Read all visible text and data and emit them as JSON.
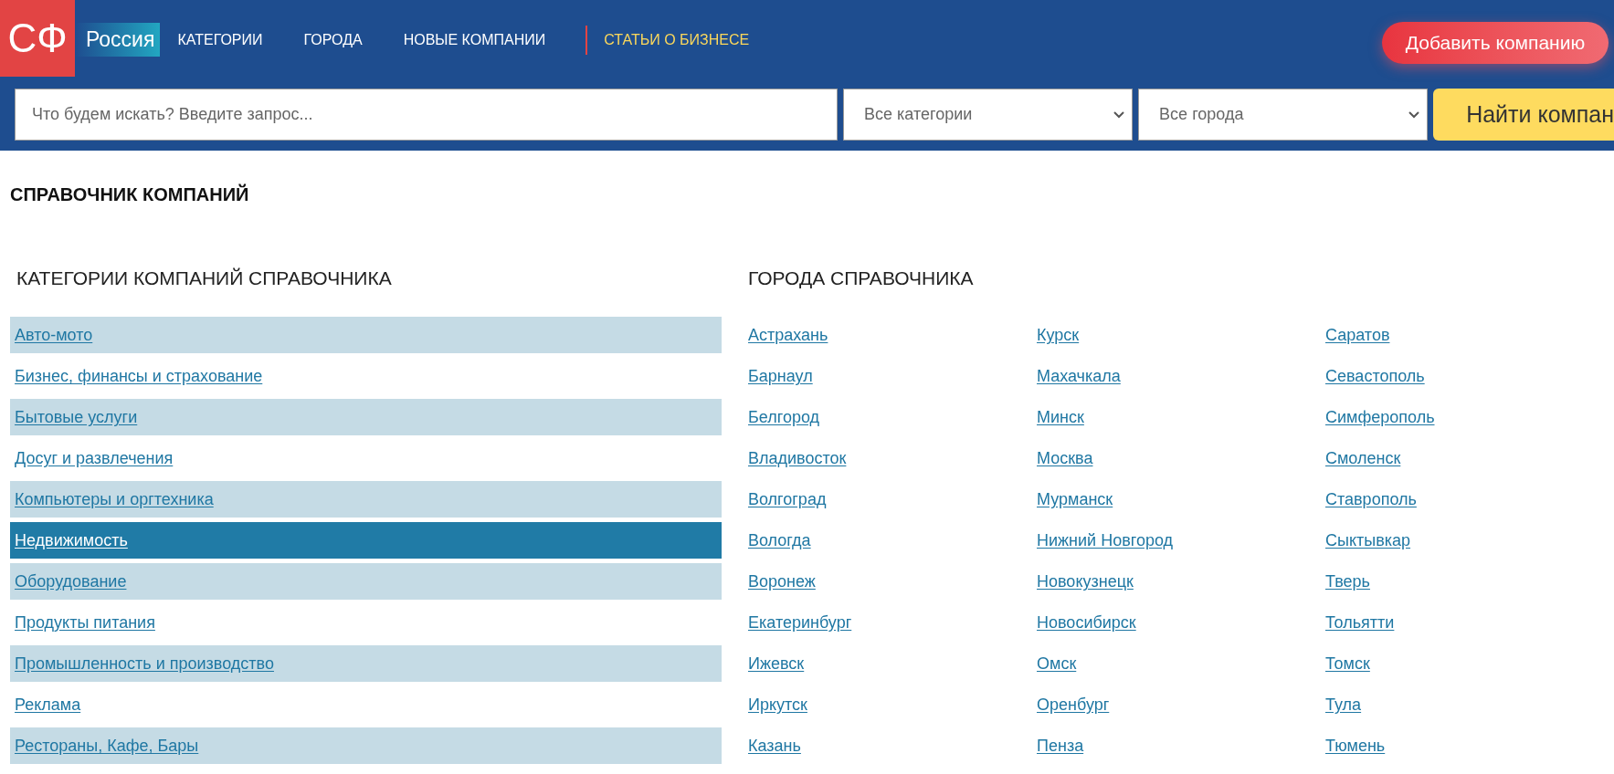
{
  "header": {
    "logo": "СФ",
    "region": "Россия",
    "nav": [
      {
        "label": "КАТЕГОРИИ",
        "kind": "plain"
      },
      {
        "label": "ГОРОДА",
        "kind": "plain"
      },
      {
        "label": "НОВЫЕ КОМПАНИИ",
        "kind": "plain"
      },
      {
        "label": "СТАТЬИ О БИЗНЕСЕ",
        "kind": "highlight"
      }
    ],
    "add_button": "Добавить компанию"
  },
  "search": {
    "placeholder": "Что будем искать? Введите запрос...",
    "category_select": "Все категории",
    "city_select": "Все города",
    "button": "Найти компан"
  },
  "page_title": "СПРАВОЧНИК КОМПАНИЙ",
  "categories": {
    "heading": "КАТЕГОРИИ КОМПАНИЙ СПРАВОЧНИКА",
    "items": [
      {
        "label": "Авто-мото",
        "selected": false
      },
      {
        "label": "Бизнес, финансы и страхование",
        "selected": false
      },
      {
        "label": "Бытовые услуги",
        "selected": false
      },
      {
        "label": "Досуг и развлечения",
        "selected": false
      },
      {
        "label": "Компьютеры и оргтехника",
        "selected": false
      },
      {
        "label": "Недвижимость",
        "selected": true
      },
      {
        "label": "Оборудование",
        "selected": false
      },
      {
        "label": "Продукты питания",
        "selected": false
      },
      {
        "label": "Промышленность и производство",
        "selected": false
      },
      {
        "label": "Реклама",
        "selected": false
      },
      {
        "label": "Рестораны, Кафе, Бары",
        "selected": false
      }
    ]
  },
  "cities": {
    "heading": "ГОРОДА СПРАВОЧНИКА",
    "columns": [
      [
        "Астрахань",
        "Барнаул",
        "Белгород",
        "Владивосток",
        "Волгоград",
        "Вологда",
        "Воронеж",
        "Екатеринбург",
        "Ижевск",
        "Иркутск",
        "Казань"
      ],
      [
        "Курск",
        "Махачкала",
        "Минск",
        "Москва",
        "Мурманск",
        "Нижний Новгород",
        "Новокузнецк",
        "Новосибирск",
        "Омск",
        "Оренбург",
        "Пенза"
      ],
      [
        "Саратов",
        "Севастополь",
        "Симферополь",
        "Смоленск",
        "Ставрополь",
        "Сыктывкар",
        "Тверь",
        "Тольятти",
        "Томск",
        "Тула",
        "Тюмень"
      ]
    ]
  }
}
